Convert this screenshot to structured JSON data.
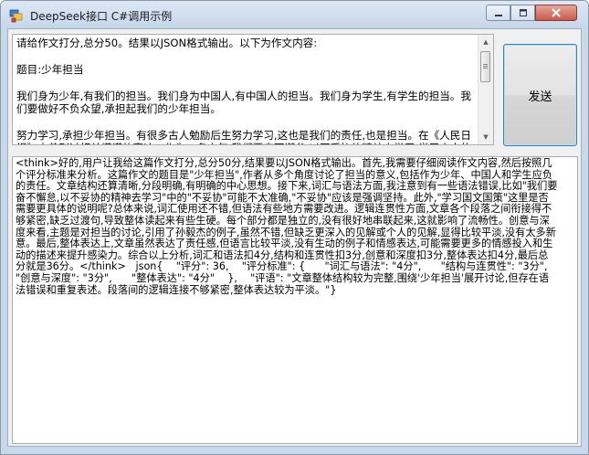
{
  "window": {
    "title": "DeepSeek接口 C#调用示例",
    "icon": "app-window-icon"
  },
  "caption_buttons": {
    "minimize_icon": "minimize-icon",
    "maximize_icon": "maximize-icon",
    "close_icon": "close-icon"
  },
  "prompt": {
    "value": "请给作文打分,总分50。结果以JSON格式输出。以下为作文内容:\n\n题目:少年担当\n\n我们身为少年,有我们的担当。我们身为中国人,有中国人的担当。我们身为学生,有学生的担当。我们要做好不负众望,承担起我们的少年担当。\n\n努力学习,承担少年担当。有很多古人勉励后生努力学习,这也是我们的责任,也是担当。在《人民日报》中曾刊过相关懂懂的事迹。作为一名少年,我们要奋不懈怠,以不妥协的精神去学习,学习古人的智慧与恒独特品质,学习古人对我们的勉励与告诫。"
  },
  "send_button": {
    "label": "发送"
  },
  "result": {
    "value": "<think>好的,用户让我给这篇作文打分,总分50分,结果要以JSON格式输出。首先,我需要仔细阅读作文内容,然后按照几个评分标准来分析。这篇作文的题目是\"少年担当\",作者从多个角度讨论了担当的意义,包括作为少年、中国人和学生应负的责任。文章结构还算清晰,分段明确,有明确的中心思想。接下来,词汇与语法方面,我注意到有一些语法错误,比如\"我们要奋不懈怠,以不妥协的精神去学习\"中的\"不妥协\"可能不太准确,\"不妥协\"应该是强调坚持。此外,\"学习国文国策\"这里是否需要更具体的说明呢?总体来说,词汇使用还不错,但语法有些地方需要改进。逻辑连贯性方面,文章各个段落之间衔接得不够紧密,缺乏过渡句,导致整体读起来有些生硬。每个部分都是独立的,没有很好地串联起来,这就影响了流畅性。创意与深度来看,主题是对担当的讨论,引用了孙毅杰的例子,虽然不错,但缺乏更深入的见解或个人的见解,显得比较平淡,没有太多新意。最后,整体表达上,文章虽然表达了责任感,但语言比较平淡,没有生动的例子和情感表达,可能需要更多的情感投入和生动的描述来提升感染力。综合以上分析,词汇和语法扣4分,结构和连贯性扣3分,创意和深度扣3分,整体表达扣4分,最后总分就是36分。</think>   json{    \"评分\": 36,    \"评分标准\": {      \"词汇与语法\": \"4分\",      \"结构与连贯性\": \"3分\",      \"创意与深度\": \"3分\",      \"整体表达\": \"4分\"    },    \"评语\": \"文章整体结构较为完整,围绕'少年担当'展开讨论,但存在语法错误和重复表述。段落间的逻辑连接不够紧密,整体表达较为平淡。\"}"
  },
  "colors": {
    "titlebar_top": "#dde8f5",
    "titlebar_bottom": "#c6d6ea",
    "client_background": "#f0f0f0",
    "button_border_focus": "#3c7fb1",
    "close_button": "#c9594a"
  }
}
